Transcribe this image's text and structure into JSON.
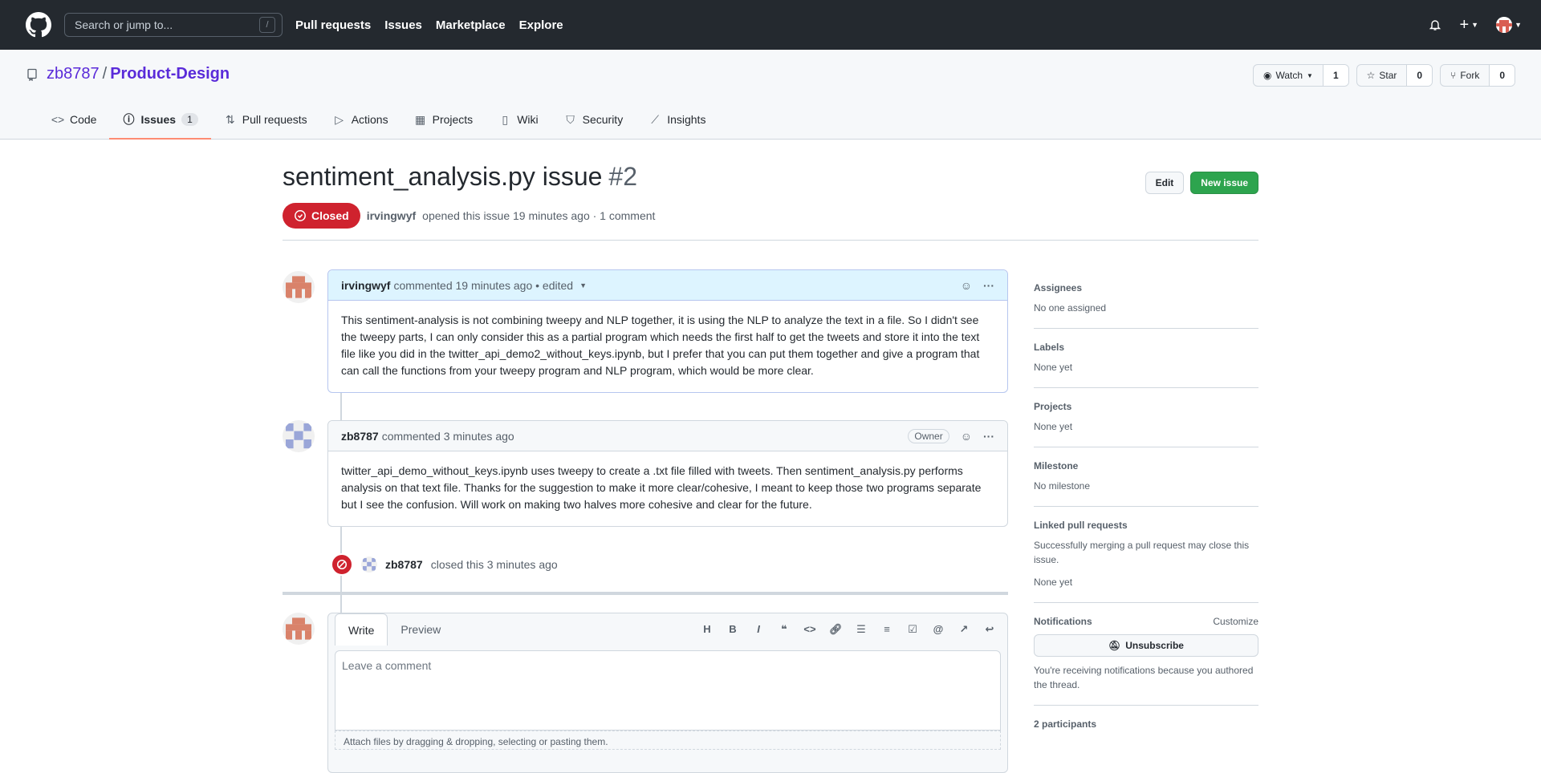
{
  "header": {
    "search_placeholder": "Search or jump to...",
    "search_shortcut": "/",
    "nav": [
      "Pull requests",
      "Issues",
      "Marketplace",
      "Explore"
    ]
  },
  "repo": {
    "owner": "zb8787",
    "separator": "/",
    "name": "Product-Design",
    "watch_label": "Watch",
    "watch_count": "1",
    "star_label": "Star",
    "star_count": "0",
    "fork_label": "Fork",
    "fork_count": "0"
  },
  "tabs": {
    "code": "Code",
    "issues": "Issues",
    "issues_count": "1",
    "pulls": "Pull requests",
    "actions": "Actions",
    "projects": "Projects",
    "wiki": "Wiki",
    "security": "Security",
    "insights": "Insights"
  },
  "issue": {
    "title": "sentiment_analysis.py issue",
    "number": "#2",
    "edit_label": "Edit",
    "new_issue_label": "New issue",
    "status": "Closed",
    "author": "irvingwyf",
    "meta_text": "opened this issue 19 minutes ago · 1 comment"
  },
  "comments": [
    {
      "author": "irvingwyf",
      "meta": "commented 19 minutes ago • edited",
      "body": "This sentiment-analysis is not combining tweepy and NLP together, it is using the NLP to analyze the text in a file. So I didn't see the tweepy parts, I can only consider this as a partial program which needs the first half to get the tweets and store it into the text file like you did in the twitter_api_demo2_without_keys.ipynb, but I prefer that you can put them together and give a program that can call the functions from your tweepy program and NLP program, which would be more clear."
    },
    {
      "author": "zb8787",
      "meta": "commented 3 minutes ago",
      "badge": "Owner",
      "body": "twitter_api_demo_without_keys.ipynb uses tweepy to create a .txt file filled with tweets. Then sentiment_analysis.py performs analysis on that text file. Thanks for the suggestion to make it more clear/cohesive, I meant to keep those two programs separate but I see the confusion. Will work on making two halves more cohesive and clear for the future."
    }
  ],
  "closed_event": {
    "actor": "zb8787",
    "text": "closed this 3 minutes ago"
  },
  "editor": {
    "write_tab": "Write",
    "preview_tab": "Preview",
    "placeholder": "Leave a comment",
    "attach_text": "Attach files by dragging & dropping, selecting or pasting them."
  },
  "sidebar": {
    "assignees_h": "Assignees",
    "assignees_v": "No one assigned",
    "labels_h": "Labels",
    "labels_v": "None yet",
    "projects_h": "Projects",
    "projects_v": "None yet",
    "milestone_h": "Milestone",
    "milestone_v": "No milestone",
    "linked_h": "Linked pull requests",
    "linked_desc": "Successfully merging a pull request may close this issue.",
    "linked_v": "None yet",
    "notif_h": "Notifications",
    "notif_customize": "Customize",
    "unsubscribe": "Unsubscribe",
    "notif_reason": "You're receiving notifications because you authored the thread.",
    "participants_h": "2 participants"
  }
}
